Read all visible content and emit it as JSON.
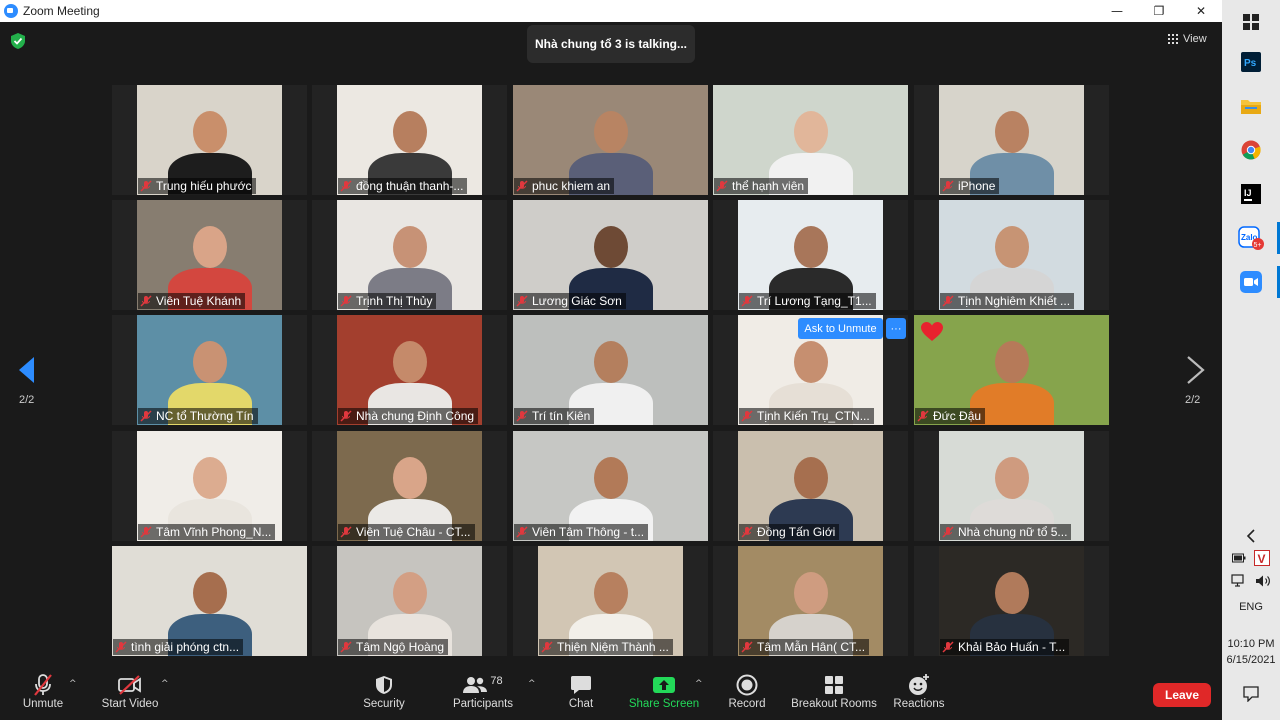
{
  "window": {
    "title": "Zoom Meeting",
    "controls": {
      "minimize": "—",
      "maximize": "❐",
      "close": "✕"
    }
  },
  "meeting": {
    "talking_indicator": "Nhà chung tổ 3 is talking...",
    "view_label": "View",
    "page_left": "2/2",
    "page_right": "2/2",
    "ask_to_unmute": "Ask to Unmute",
    "more": "···"
  },
  "participants": [
    {
      "name": "Trung hiếu phước",
      "bg": "#d9d4ca",
      "skin": "#c98f6b",
      "shirt": "#1d1d1d",
      "narrow": true
    },
    {
      "name": "đồng thuận thanh-...",
      "bg": "#ece8e2",
      "skin": "#b77f5f",
      "shirt": "#3a3a3a",
      "narrow": true
    },
    {
      "name": "phuc khiem an",
      "bg": "#9a8877",
      "skin": "#b88463",
      "shirt": "#5a5f78",
      "narrow": false
    },
    {
      "name": "thể hạnh viên",
      "bg": "#cfd6cc",
      "skin": "#e1b69a",
      "shirt": "#f1f1f1",
      "narrow": false
    },
    {
      "name": "iPhone",
      "bg": "#d7d4cb",
      "skin": "#b98262",
      "shirt": "#6f8fa7",
      "narrow": true
    },
    {
      "name": "Viên Tuệ Khánh",
      "bg": "#877d70",
      "skin": "#d9a488",
      "shirt": "#d3473f",
      "narrow": true
    },
    {
      "name": "Trịnh Thị Thủy",
      "bg": "#e9e6e2",
      "skin": "#c79276",
      "shirt": "#7c7c86",
      "narrow": true
    },
    {
      "name": "Lương Giác Sơn",
      "bg": "#cfcdc9",
      "skin": "#6e4a35",
      "shirt": "#1f2b44",
      "narrow": false
    },
    {
      "name": "Trí Lương Tạng_T1...",
      "bg": "#e7ecef",
      "skin": "#a8765a",
      "shirt": "#2a2a2a",
      "narrow": true
    },
    {
      "name": "Tịnh Nghiêm Khiết ...",
      "bg": "#d2dbe0",
      "skin": "#c79474",
      "shirt": "#d5d5d5",
      "narrow": true
    },
    {
      "name": "NC tổ Thường Tín",
      "bg": "#5d8fa6",
      "skin": "#c99273",
      "shirt": "#e3d86a",
      "narrow": true
    },
    {
      "name": "Nhà chung Định Công",
      "bg": "#a33f2e",
      "skin": "#c58a6a",
      "shirt": "#e9e6e3",
      "narrow": true
    },
    {
      "name": "Trí tín Kiên",
      "bg": "#bdbfbd",
      "skin": "#b47f5e",
      "shirt": "#f0f0f0",
      "narrow": false
    },
    {
      "name": "Tịnh Kiến Trụ_CTN...",
      "bg": "#f0ece6",
      "skin": "#c68f70",
      "shirt": "#e6dfd6",
      "narrow": true
    },
    {
      "name": "Đức Đậu",
      "bg": "#86a44c",
      "skin": "#b67a59",
      "shirt": "#e17c28",
      "narrow": false
    },
    {
      "name": "Tâm Vĩnh Phong_N...",
      "bg": "#f0ede8",
      "skin": "#dcac90",
      "shirt": "#e9e5de",
      "narrow": true
    },
    {
      "name": "Viên Tuệ Châu - CT...",
      "bg": "#7d6a4e",
      "skin": "#d9a589",
      "shirt": "#ebe9e6",
      "narrow": true
    },
    {
      "name": "Viên Tâm Thông - t...",
      "bg": "#c6c7c4",
      "skin": "#b27a58",
      "shirt": "#f2f2f2",
      "narrow": false
    },
    {
      "name": "Đồng Tấn Giới",
      "bg": "#cabfae",
      "skin": "#a66f4f",
      "shirt": "#2d3a52",
      "narrow": true
    },
    {
      "name": "Nhà chung nữ tổ 5...",
      "bg": "#d7dbd6",
      "skin": "#cf9b7f",
      "shirt": "#dedbd8",
      "narrow": true
    },
    {
      "name": "tình giải phóng ctn...",
      "bg": "#e0ddd6",
      "skin": "#a66e4e",
      "shirt": "#3d5f7e",
      "narrow": false
    },
    {
      "name": "Tâm Ngộ Hoàng",
      "bg": "#c6c4bf",
      "skin": "#d39f84",
      "shirt": "#e8e3dd",
      "narrow": true
    },
    {
      "name": "Thiện Niệm Thành ...",
      "bg": "#d2c6b4",
      "skin": "#b7805f",
      "shirt": "#f2efe9",
      "narrow": true
    },
    {
      "name": "Tâm Mẫn Hân( CT...",
      "bg": "#a38b64",
      "skin": "#cf9c80",
      "shirt": "#d6d2cc",
      "narrow": true
    },
    {
      "name": "Khải Bảo Huấn - T...",
      "bg": "#2c2925",
      "skin": "#b07a5b",
      "shirt": "#27313f",
      "narrow": true
    }
  ],
  "toolbar": {
    "unmute": "Unmute",
    "start_video": "Start Video",
    "security": "Security",
    "participants": "Participants",
    "participants_count": "78",
    "chat": "Chat",
    "share_screen": "Share Screen",
    "record": "Record",
    "breakout_rooms": "Breakout Rooms",
    "reactions": "Reactions",
    "leave": "Leave"
  },
  "taskbar": {
    "apps": [
      "windows-start",
      "photoshop",
      "file-explorer",
      "chrome",
      "intellij",
      "zalo",
      "zoom"
    ],
    "zalo_badge": "5+",
    "language": "ENG",
    "time": "10:10 PM",
    "date": "6/15/2021"
  },
  "colors": {
    "accent_blue": "#2d8cff",
    "share_green": "#23d959",
    "leave_red": "#e02828",
    "muted_red": "#e0383e"
  }
}
